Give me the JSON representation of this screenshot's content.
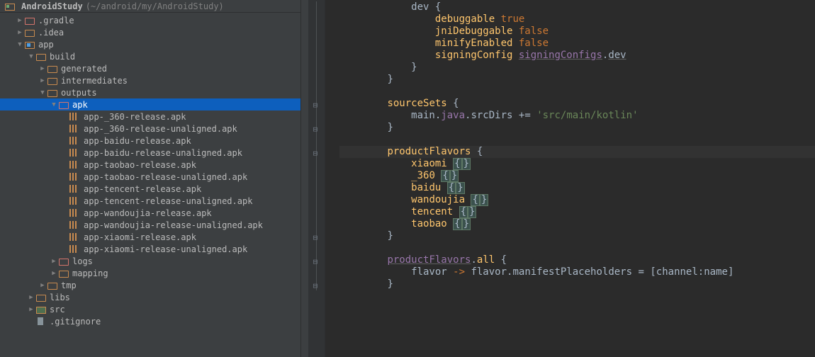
{
  "project": {
    "name": "AndroidStudy",
    "path_hint": "(~/android/my/AndroidStudy)"
  },
  "tree": [
    {
      "d": 1,
      "t": "closed",
      "i": "folder pink",
      "l": ".gradle"
    },
    {
      "d": 1,
      "t": "closed",
      "i": "folder",
      "l": ".idea"
    },
    {
      "d": 1,
      "t": "open",
      "i": "module",
      "l": "app"
    },
    {
      "d": 2,
      "t": "open",
      "i": "folder",
      "l": "build"
    },
    {
      "d": 3,
      "t": "closed",
      "i": "folder",
      "l": "generated"
    },
    {
      "d": 3,
      "t": "closed",
      "i": "folder",
      "l": "intermediates"
    },
    {
      "d": 3,
      "t": "open",
      "i": "folder",
      "l": "outputs"
    },
    {
      "d": 4,
      "t": "open",
      "i": "folder pink",
      "l": "apk",
      "sel": true
    },
    {
      "d": 5,
      "t": "none",
      "i": "apk",
      "l": "app-_360-release.apk"
    },
    {
      "d": 5,
      "t": "none",
      "i": "apk",
      "l": "app-_360-release-unaligned.apk"
    },
    {
      "d": 5,
      "t": "none",
      "i": "apk",
      "l": "app-baidu-release.apk"
    },
    {
      "d": 5,
      "t": "none",
      "i": "apk",
      "l": "app-baidu-release-unaligned.apk"
    },
    {
      "d": 5,
      "t": "none",
      "i": "apk",
      "l": "app-taobao-release.apk"
    },
    {
      "d": 5,
      "t": "none",
      "i": "apk",
      "l": "app-taobao-release-unaligned.apk"
    },
    {
      "d": 5,
      "t": "none",
      "i": "apk",
      "l": "app-tencent-release.apk"
    },
    {
      "d": 5,
      "t": "none",
      "i": "apk",
      "l": "app-tencent-release-unaligned.apk"
    },
    {
      "d": 5,
      "t": "none",
      "i": "apk",
      "l": "app-wandoujia-release.apk"
    },
    {
      "d": 5,
      "t": "none",
      "i": "apk",
      "l": "app-wandoujia-release-unaligned.apk"
    },
    {
      "d": 5,
      "t": "none",
      "i": "apk",
      "l": "app-xiaomi-release.apk"
    },
    {
      "d": 5,
      "t": "none",
      "i": "apk",
      "l": "app-xiaomi-release-unaligned.apk"
    },
    {
      "d": 4,
      "t": "closed",
      "i": "folder pink",
      "l": "logs"
    },
    {
      "d": 4,
      "t": "closed",
      "i": "folder",
      "l": "mapping"
    },
    {
      "d": 3,
      "t": "closed",
      "i": "folder",
      "l": "tmp"
    },
    {
      "d": 2,
      "t": "closed",
      "i": "folder",
      "l": "libs"
    },
    {
      "d": 2,
      "t": "closed",
      "i": "src",
      "l": "src"
    },
    {
      "d": 2,
      "t": "none",
      "i": "file",
      "l": ".gitignore"
    }
  ],
  "code": {
    "lines": [
      {
        "seg": [
          {
            "c": "id",
            "t": "            dev "
          },
          {
            "c": "punc",
            "t": "{"
          }
        ]
      },
      {
        "seg": [
          {
            "c": "id",
            "t": "                "
          },
          {
            "c": "meth",
            "t": "debuggable"
          },
          {
            "c": "id",
            "t": " "
          },
          {
            "c": "bval",
            "t": "true"
          }
        ]
      },
      {
        "seg": [
          {
            "c": "id",
            "t": "                "
          },
          {
            "c": "meth",
            "t": "jniDebuggable"
          },
          {
            "c": "id",
            "t": " "
          },
          {
            "c": "bval",
            "t": "false"
          }
        ]
      },
      {
        "seg": [
          {
            "c": "id",
            "t": "                "
          },
          {
            "c": "meth",
            "t": "minifyEnabled"
          },
          {
            "c": "id",
            "t": " "
          },
          {
            "c": "bval",
            "t": "false"
          }
        ]
      },
      {
        "seg": [
          {
            "c": "id",
            "t": "                "
          },
          {
            "c": "meth",
            "t": "signingConfig"
          },
          {
            "c": "id",
            "t": " "
          },
          {
            "c": "lit uline",
            "t": "signingConfigs"
          },
          {
            "c": "punc",
            "t": "."
          },
          {
            "c": "id uline",
            "t": "dev"
          }
        ]
      },
      {
        "seg": [
          {
            "c": "id",
            "t": "            "
          },
          {
            "c": "punc",
            "t": "}"
          }
        ]
      },
      {
        "seg": [
          {
            "c": "id",
            "t": "        "
          },
          {
            "c": "punc",
            "t": "}"
          }
        ]
      },
      {
        "blank": true
      },
      {
        "seg": [
          {
            "c": "id",
            "t": "        "
          },
          {
            "c": "meth",
            "t": "sourceSets"
          },
          {
            "c": "id",
            "t": " "
          },
          {
            "c": "punc",
            "t": "{"
          }
        ],
        "fold": "minus"
      },
      {
        "seg": [
          {
            "c": "id",
            "t": "            main"
          },
          {
            "c": "punc",
            "t": "."
          },
          {
            "c": "lit",
            "t": "java"
          },
          {
            "c": "punc",
            "t": "."
          },
          {
            "c": "id",
            "t": "srcDirs"
          },
          {
            "c": "id",
            "t": " "
          },
          {
            "c": "punc",
            "t": "+= "
          },
          {
            "c": "str",
            "t": "'src/main/kotlin'"
          }
        ]
      },
      {
        "seg": [
          {
            "c": "id",
            "t": "        "
          },
          {
            "c": "punc",
            "t": "}"
          }
        ],
        "fold": "end"
      },
      {
        "blank": true
      },
      {
        "seg": [
          {
            "c": "id",
            "t": "        "
          },
          {
            "c": "meth",
            "t": "productFlavors"
          },
          {
            "c": "id",
            "t": " "
          },
          {
            "c": "punc",
            "t": "{"
          }
        ],
        "fold": "minus",
        "cur": true
      },
      {
        "seg": [
          {
            "c": "id",
            "t": "            "
          },
          {
            "c": "meth",
            "t": "xiaomi"
          },
          {
            "c": "id",
            "t": " "
          },
          {
            "c": "bracehl",
            "t": "{"
          },
          {
            "c": "bracehl",
            "t": "}"
          }
        ]
      },
      {
        "seg": [
          {
            "c": "id",
            "t": "            "
          },
          {
            "c": "meth",
            "t": "_360"
          },
          {
            "c": "id",
            "t": " "
          },
          {
            "c": "bracehl",
            "t": "{"
          },
          {
            "c": "bracehl",
            "t": "}"
          }
        ]
      },
      {
        "seg": [
          {
            "c": "id",
            "t": "            "
          },
          {
            "c": "meth",
            "t": "baidu"
          },
          {
            "c": "id",
            "t": " "
          },
          {
            "c": "bracehl",
            "t": "{"
          },
          {
            "c": "bracehl",
            "t": "}"
          }
        ]
      },
      {
        "seg": [
          {
            "c": "id",
            "t": "            "
          },
          {
            "c": "meth",
            "t": "wandoujia"
          },
          {
            "c": "id",
            "t": " "
          },
          {
            "c": "bracehl",
            "t": "{"
          },
          {
            "c": "bracehl",
            "t": "}"
          }
        ]
      },
      {
        "seg": [
          {
            "c": "id",
            "t": "            "
          },
          {
            "c": "meth",
            "t": "tencent"
          },
          {
            "c": "id",
            "t": " "
          },
          {
            "c": "bracehl",
            "t": "{"
          },
          {
            "c": "bracehl",
            "t": "}"
          }
        ]
      },
      {
        "seg": [
          {
            "c": "id",
            "t": "            "
          },
          {
            "c": "meth",
            "t": "taobao"
          },
          {
            "c": "id",
            "t": " "
          },
          {
            "c": "bracehl",
            "t": "{"
          },
          {
            "c": "bracehl",
            "t": "}"
          }
        ]
      },
      {
        "seg": [
          {
            "c": "id",
            "t": "        "
          },
          {
            "c": "punc",
            "t": "}"
          }
        ],
        "fold": "end"
      },
      {
        "blank": true
      },
      {
        "seg": [
          {
            "c": "id",
            "t": "        "
          },
          {
            "c": "lit uline",
            "t": "productFlavors"
          },
          {
            "c": "punc",
            "t": "."
          },
          {
            "c": "meth",
            "t": "all"
          },
          {
            "c": "id",
            "t": " "
          },
          {
            "c": "punc",
            "t": "{"
          }
        ],
        "fold": "minus"
      },
      {
        "seg": [
          {
            "c": "id",
            "t": "            flavor "
          },
          {
            "c": "kw",
            "t": "->"
          },
          {
            "c": "id",
            "t": " flavor"
          },
          {
            "c": "punc",
            "t": "."
          },
          {
            "c": "id",
            "t": "manifestPlaceholders"
          },
          {
            "c": "id",
            "t": " "
          },
          {
            "c": "punc",
            "t": "= ["
          },
          {
            "c": "id",
            "t": "channel"
          },
          {
            "c": "punc",
            "t": ":"
          },
          {
            "c": "id",
            "t": "name"
          },
          {
            "c": "punc",
            "t": "]"
          }
        ]
      },
      {
        "seg": [
          {
            "c": "id",
            "t": "        "
          },
          {
            "c": "punc",
            "t": "}"
          }
        ],
        "fold": "end"
      }
    ]
  }
}
